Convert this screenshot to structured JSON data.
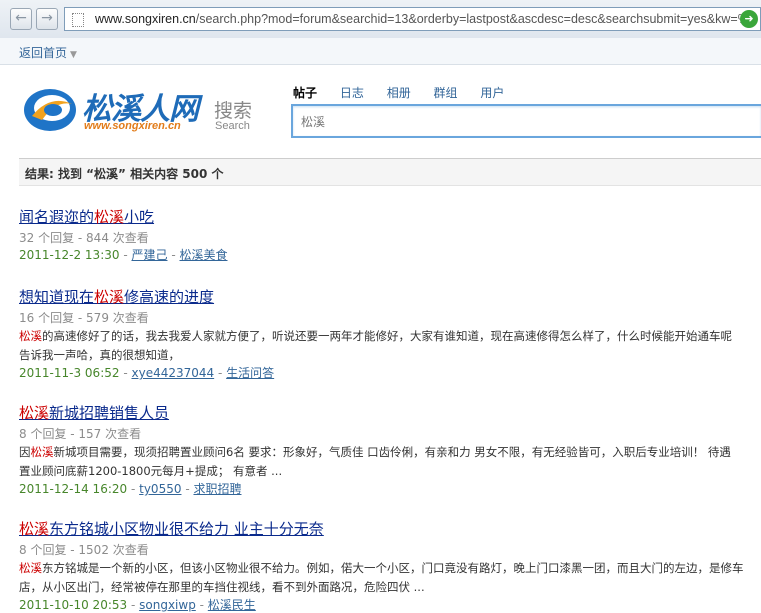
{
  "browser": {
    "url_host": "www.songxiren.cn",
    "url_rest": "/search.php?mod=forum&searchid=13&orderby=lastpost&ascdesc=desc&searchsubmit=yes&kw=%",
    "back_icon": "back-arrow-icon",
    "forward_icon": "forward-arrow-icon",
    "go_icon": "go-arrow-icon"
  },
  "topbar": {
    "home_label": "返回首页"
  },
  "logo": {
    "name": "松溪人网",
    "url": "www.songxiren.cn",
    "search_cn": "搜索",
    "search_en": "Search"
  },
  "tabs": [
    {
      "label": "帖子",
      "active": true
    },
    {
      "label": "日志",
      "active": false
    },
    {
      "label": "相册",
      "active": false
    },
    {
      "label": "群组",
      "active": false
    },
    {
      "label": "用户",
      "active": false
    }
  ],
  "search": {
    "value": "松溪"
  },
  "result_summary": "结果: 找到 “松溪” 相关内容 500 个",
  "results": [
    {
      "title_pre": "闻名遐迩的",
      "title_hl": "松溪",
      "title_post": "小吃",
      "meta": "32 个回复 - 844 次查看",
      "snippet": [],
      "date": "2011-12-2 13:30",
      "author": "严建己",
      "forum": "松溪美食"
    },
    {
      "title_pre": "想知道现在",
      "title_hl": "松溪",
      "title_post": "修高速的进度",
      "meta": "16 个回复 - 579 次查看",
      "snippet": [
        {
          "hl": "松溪",
          "text": "的高速修好了的话，我去我爱人家就方便了，听说还要一两年才能修好，大家有谁知道，现在高速修得怎么样了，什么时候能开始通车呢"
        },
        {
          "hl": "",
          "text": "告诉我一声哈，真的很想知道，"
        }
      ],
      "date": "2011-11-3 06:52",
      "author": "xye44237044",
      "forum": "生活问答"
    },
    {
      "title_pre": "",
      "title_hl": "松溪",
      "title_post": "新城招聘销售人员",
      "meta": "8 个回复 - 157 次查看",
      "snippet": [
        {
          "pre": "因",
          "hl": "松溪",
          "text": "新城项目需要，现须招聘置业顾问6名 要求：形象好，气质佳 口齿伶俐，有亲和力 男女不限，有无经验皆可，入职后专业培训！ 待遇"
        },
        {
          "hl": "",
          "text": "置业顾问底薪1200-1800元每月+提成； 有意者 ..."
        }
      ],
      "date": "2011-12-14 16:20",
      "author": "ty0550",
      "forum": "求职招聘"
    },
    {
      "title_pre": "",
      "title_hl": "松溪",
      "title_post": "东方铭城小区物业很不给力 业主十分无奈",
      "meta": "8 个回复 - 1502 次查看",
      "snippet": [
        {
          "hl": "松溪",
          "text": "东方铭城是一个新的小区，但该小区物业很不给力。例如，偌大一个小区，门口竟没有路灯，晚上门口漆黑一团，而且大门的左边，是修车"
        },
        {
          "hl": "",
          "text": "店，从小区出门，经常被停在那里的车挡住视线，看不到外面路况，危险四伏 ..."
        }
      ],
      "date": "2011-10-10 20:53",
      "author": "songxiwp",
      "forum": "松溪民生"
    }
  ],
  "colors": {
    "link": "#0a2a8c",
    "highlight": "#cc0000",
    "date": "#47862b",
    "accent_blue": "#336699"
  }
}
